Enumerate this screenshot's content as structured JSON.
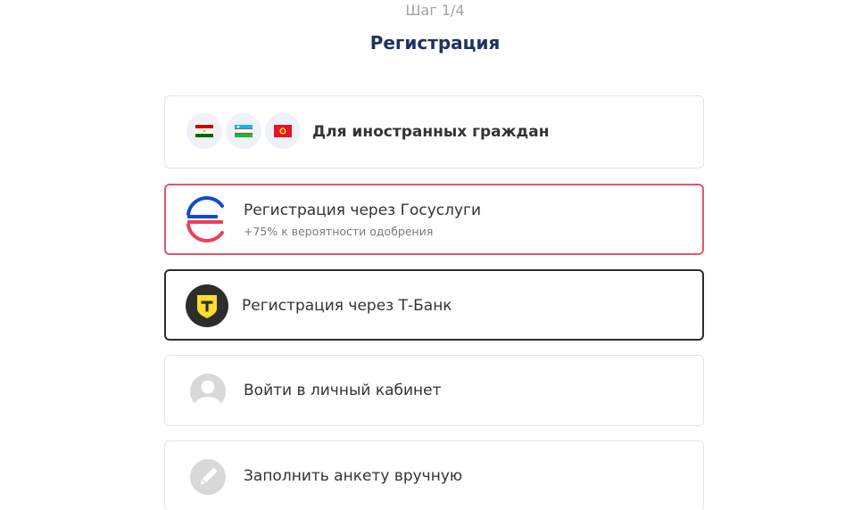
{
  "header": {
    "step": "Шаг 1/4",
    "title": "Регистрация"
  },
  "options": {
    "foreign": {
      "label": "Для иностранных граждан",
      "flags": [
        "tajikistan-flag-icon",
        "uzbekistan-flag-icon",
        "kyrgyzstan-flag-icon"
      ]
    },
    "gosuslugi": {
      "label": "Регистрация через Госуслуги",
      "sub": "+75% к вероятности одобрения",
      "icon": "gosuslugi-logo-icon"
    },
    "tbank": {
      "label": "Регистрация через Т-Банк",
      "icon": "tbank-logo-icon"
    },
    "login": {
      "label": "Войти в личный кабинет",
      "icon": "user-avatar-icon"
    },
    "manual": {
      "label": "Заполнить анкету вручную",
      "icon": "pencil-icon"
    }
  },
  "colors": {
    "title": "#1d3260",
    "gosuslugi_border": "#e1566b",
    "tbank_border": "#2d2d2d",
    "tbank_yellow": "#ffdd2d",
    "gos_blue": "#0d4cd3",
    "gos_red": "#ee3f58",
    "gray_icon": "#d8d8d8"
  }
}
